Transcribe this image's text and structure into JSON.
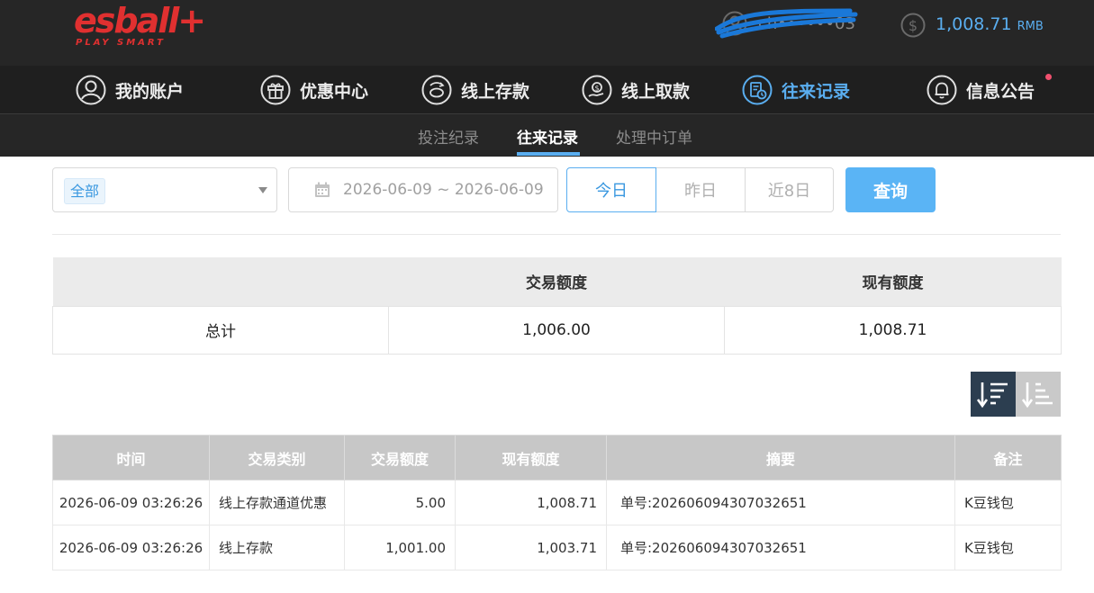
{
  "header": {
    "logo_text": "esball+",
    "logo_tagline": "PLAY SMART",
    "username": "ch••••••03",
    "balance": "1,008.71",
    "currency": "RMB"
  },
  "main_nav": [
    {
      "label": "我的账户",
      "icon": "user-circle-icon",
      "active": false
    },
    {
      "label": "优惠中心",
      "icon": "gift-icon",
      "active": false
    },
    {
      "label": "线上存款",
      "icon": "deposit-icon",
      "active": false
    },
    {
      "label": "线上取款",
      "icon": "withdraw-icon",
      "active": false
    },
    {
      "label": "往来记录",
      "icon": "records-icon",
      "active": true
    },
    {
      "label": "信息公告",
      "icon": "bell-icon",
      "active": false
    }
  ],
  "sub_nav": [
    {
      "label": "投注纪录",
      "active": false
    },
    {
      "label": "往来记录",
      "active": true
    },
    {
      "label": "处理中订单",
      "active": false
    }
  ],
  "filters": {
    "type_value": "全部",
    "date_range": "2026-06-09 ~ 2026-06-09",
    "quick_today": "今日",
    "quick_yesterday": "昨日",
    "quick_last8": "近8日",
    "query_label": "查询"
  },
  "summary": {
    "headers": [
      "",
      "交易额度",
      "现有额度"
    ],
    "row": {
      "label": "总计",
      "amount": "1,006.00",
      "balance": "1,008.71"
    }
  },
  "records": {
    "headers": [
      "时间",
      "交易类别",
      "交易额度",
      "现有额度",
      "摘要",
      "备注"
    ],
    "rows": [
      [
        "2026-06-09 03:26:26",
        "线上存款通道优惠",
        "5.00",
        "1,008.71",
        "单号:202606094307032651",
        "K豆钱包"
      ],
      [
        "2026-06-09 03:26:26",
        "线上存款",
        "1,001.00",
        "1,003.71",
        "单号:202606094307032651",
        "K豆钱包"
      ]
    ]
  },
  "colors": {
    "accent": "#5aaef0",
    "brand_red": "#e03030",
    "topbar_bg": "#262626",
    "sort_active": "#2c3e50"
  }
}
